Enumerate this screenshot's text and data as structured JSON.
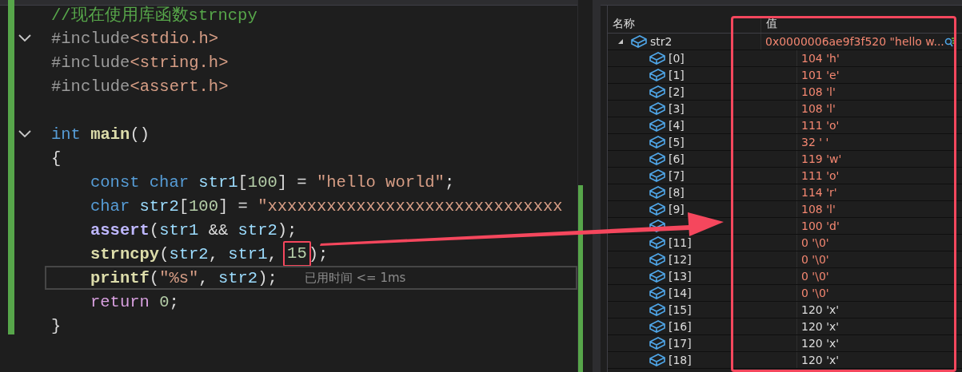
{
  "editor": {
    "lines": [
      {
        "tokens": [
          {
            "text": "//现在使用库函数strncpy",
            "kind": "comment"
          }
        ]
      },
      {
        "fold": true,
        "tokens": [
          {
            "text": "#include",
            "kind": "directive"
          },
          {
            "text": "<stdio.h>",
            "kind": "header"
          }
        ]
      },
      {
        "tokens": [
          {
            "text": "#include",
            "kind": "directive"
          },
          {
            "text": "<string.h>",
            "kind": "header"
          }
        ]
      },
      {
        "tokens": [
          {
            "text": "#include",
            "kind": "directive"
          },
          {
            "text": "<assert.h>",
            "kind": "header"
          }
        ]
      },
      {
        "fold": true,
        "blank_before": true,
        "tokens": [
          {
            "text": "int ",
            "kind": "keyword"
          },
          {
            "text": "main",
            "kind": "func"
          },
          {
            "text": "()",
            "kind": "plain"
          }
        ]
      },
      {
        "tokens": [
          {
            "text": "{",
            "kind": "plain"
          }
        ]
      },
      {
        "indented": true,
        "tokens": [
          {
            "text": "const ",
            "kind": "keyword"
          },
          {
            "text": "char ",
            "kind": "keyword"
          },
          {
            "text": "str1",
            "kind": "var"
          },
          {
            "text": "[",
            "kind": "plain"
          },
          {
            "text": "100",
            "kind": "num"
          },
          {
            "text": "] = ",
            "kind": "plain"
          },
          {
            "text": "\"hello world\"",
            "kind": "str"
          },
          {
            "text": ";",
            "kind": "plain"
          }
        ]
      },
      {
        "indented": true,
        "tokens": [
          {
            "text": "char ",
            "kind": "keyword"
          },
          {
            "text": "str2",
            "kind": "var"
          },
          {
            "text": "[",
            "kind": "plain"
          },
          {
            "text": "100",
            "kind": "num"
          },
          {
            "text": "] = ",
            "kind": "plain"
          },
          {
            "text": "\"xxxxxxxxxxxxxxxxxxxxxxxxxxxxxx",
            "kind": "str"
          }
        ]
      },
      {
        "indented": true,
        "tokens": [
          {
            "text": "assert",
            "kind": "macro"
          },
          {
            "text": "(",
            "kind": "plain"
          },
          {
            "text": "str1",
            "kind": "var"
          },
          {
            "text": " && ",
            "kind": "plain"
          },
          {
            "text": "str2",
            "kind": "var"
          },
          {
            "text": ");",
            "kind": "plain"
          }
        ]
      },
      {
        "indented": true,
        "tokens": [
          {
            "text": "strncpy",
            "kind": "func"
          },
          {
            "text": "(",
            "kind": "plain"
          },
          {
            "text": "str2",
            "kind": "var"
          },
          {
            "text": ", ",
            "kind": "plain"
          },
          {
            "text": "str1",
            "kind": "var"
          },
          {
            "text": ", ",
            "kind": "plain"
          },
          {
            "text": "15",
            "kind": "num",
            "boxed": true
          },
          {
            "text": ");",
            "kind": "plain"
          }
        ]
      },
      {
        "indented": true,
        "current": true,
        "hint": "已用时间 <= 1ms",
        "tokens": [
          {
            "text": "printf",
            "kind": "func"
          },
          {
            "text": "(",
            "kind": "plain"
          },
          {
            "text": "\"%s\"",
            "kind": "str"
          },
          {
            "text": ", ",
            "kind": "plain"
          },
          {
            "text": "str2",
            "kind": "var"
          },
          {
            "text": ");",
            "kind": "plain"
          }
        ]
      },
      {
        "indented": true,
        "tokens": [
          {
            "text": "return ",
            "kind": "control"
          },
          {
            "text": "0",
            "kind": "num"
          },
          {
            "text": ";",
            "kind": "plain"
          }
        ]
      },
      {
        "tokens": [
          {
            "text": "}",
            "kind": "plain"
          }
        ]
      }
    ]
  },
  "watch": {
    "columns": [
      "名称",
      "值"
    ],
    "root": {
      "name": "str2",
      "expanded": true,
      "value": "0x0000006ae9f3f520 \"hello w...",
      "changed": true
    },
    "children": [
      {
        "name": "[0]",
        "value": "104 'h'",
        "changed": true
      },
      {
        "name": "[1]",
        "value": "101 'e'",
        "changed": true
      },
      {
        "name": "[2]",
        "value": "108 'l'",
        "changed": true
      },
      {
        "name": "[3]",
        "value": "108 'l'",
        "changed": true
      },
      {
        "name": "[4]",
        "value": "111 'o'",
        "changed": true
      },
      {
        "name": "[5]",
        "value": "32 ' '",
        "changed": true
      },
      {
        "name": "[6]",
        "value": "119 'w'",
        "changed": true
      },
      {
        "name": "[7]",
        "value": "111 'o'",
        "changed": true
      },
      {
        "name": "[8]",
        "value": "114 'r'",
        "changed": true
      },
      {
        "name": "[9]",
        "value": "108 'l'",
        "changed": true
      },
      {
        "value": "100 'd'",
        "changed": true
      },
      {
        "name": "[11]",
        "value": "0 '\\0'",
        "changed": true
      },
      {
        "name": "[12]",
        "value": "0 '\\0'",
        "changed": true
      },
      {
        "name": "[13]",
        "value": "0 '\\0'",
        "changed": true
      },
      {
        "name": "[14]",
        "value": "0 '\\0'",
        "changed": true
      },
      {
        "name": "[15]",
        "value": "120 'x'",
        "changed": false
      },
      {
        "name": "[16]",
        "value": "120 'x'",
        "changed": false
      },
      {
        "name": "[17]",
        "value": "120 'x'",
        "changed": false
      },
      {
        "name": "[18]",
        "value": "120 'x'",
        "changed": false
      }
    ]
  }
}
